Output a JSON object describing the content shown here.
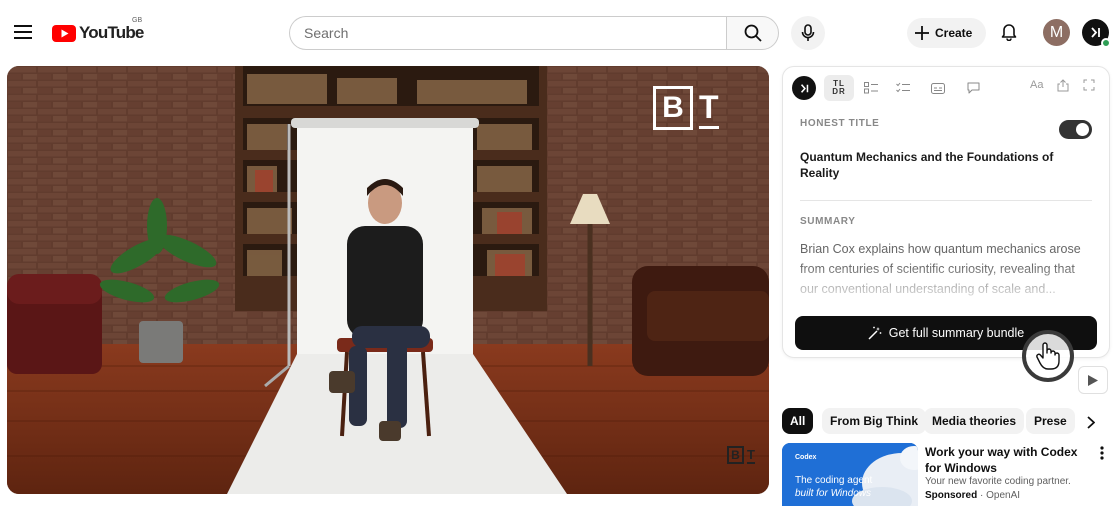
{
  "header": {
    "logo_text": "YouTube",
    "country_code": "GB",
    "search_placeholder": "Search",
    "create_label": "Create",
    "avatar_initial": "M"
  },
  "video": {
    "watermark_letter_b": "B",
    "watermark_letter_t": "T"
  },
  "panel": {
    "toolbar": {
      "tldr_top": "TL",
      "tldr_bottom": "DR",
      "font_size_label": "Aa"
    },
    "honest_title_label": "HONEST TITLE",
    "honest_title_toggle_on": true,
    "honest_title": "Quantum Mechanics and the Foundations of Reality",
    "summary_label": "SUMMARY",
    "summary_text": "Brian Cox explains how quantum mechanics arose from centuries of scientific curiosity, revealing that our conventional understanding of scale and...",
    "bundle_button": "Get full summary bundle"
  },
  "chips": [
    "All",
    "From Big Think",
    "Media theories",
    "Prese"
  ],
  "sponsored": {
    "brand": "Codex",
    "tagline_1": "The coding agent",
    "tagline_2": "built for Windows",
    "title": "Work your way with Codex for Windows",
    "description": "Your new favorite coding partner.",
    "sponsored_label": "Sponsored",
    "advertiser": "OpenAI",
    "separator": " · "
  },
  "colors": {
    "youtube_red": "#ff0000",
    "primary_text": "#0f0f0f",
    "chip_bg": "#f2f2f2",
    "button_dark": "#0f0f0f",
    "status_green": "#2e9e55"
  }
}
